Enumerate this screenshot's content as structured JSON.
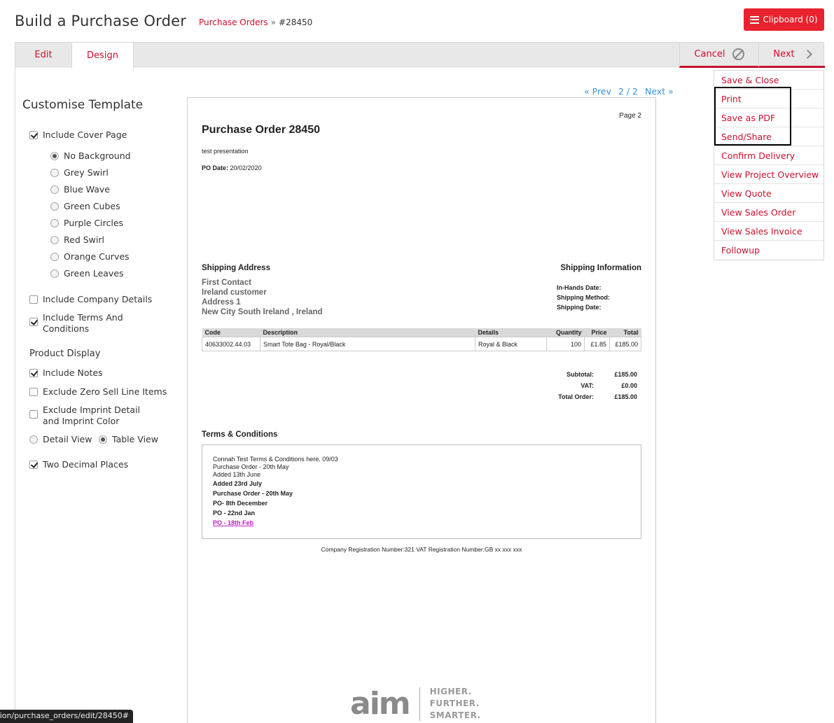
{
  "header": {
    "title": "Build a Purchase Order",
    "breadcrumb_link": "Purchase Orders",
    "breadcrumb_sep": "»",
    "breadcrumb_current": "#28450",
    "clipboard_label": "Clipboard (0)"
  },
  "tabs": {
    "edit": "Edit",
    "design": "Design",
    "cancel": "Cancel",
    "next": "Next"
  },
  "dropdown": [
    "Save & Close",
    "Print",
    "Save as PDF",
    "Send/Share",
    "Confirm Delivery",
    "View Project Overview",
    "View Quote",
    "View Sales Order",
    "View Sales Invoice",
    "Followup"
  ],
  "sidebar": {
    "title": "Customise Template",
    "include_cover_page": "Include Cover Page",
    "backgrounds": [
      "No Background",
      "Grey Swirl",
      "Blue Wave",
      "Green Cubes",
      "Purple Circles",
      "Red Swirl",
      "Orange Curves",
      "Green Leaves"
    ],
    "include_company_details": "Include Company Details",
    "include_terms": "Include Terms And Conditions",
    "product_display": "Product Display",
    "include_notes": "Include Notes",
    "exclude_zero": "Exclude Zero Sell Line Items",
    "exclude_imprint": "Exclude Imprint Detail and Imprint Color",
    "detail_view": "Detail View",
    "table_view": "Table View",
    "two_decimal": "Two Decimal Places"
  },
  "pager": {
    "prev": "« Prev",
    "pages": "2 / 2",
    "next": "Next »"
  },
  "document": {
    "page_label": "Page 2",
    "title": "Purchase Order 28450",
    "subtitle": "test presentation",
    "po_date_label": "PO Date:",
    "po_date": "20/02/2020",
    "shipping_address_heading": "Shipping Address",
    "address_lines": [
      "First Contact",
      "Ireland customer",
      "Address 1",
      "New City South Ireland , Ireland"
    ],
    "shipping_info_heading": "Shipping Information",
    "shipping_info_labels": [
      "In-Hands Date:",
      "Shipping Method:",
      "Shipping Date:"
    ],
    "table_headers": [
      "Code",
      "Description",
      "Details",
      "Quantity",
      "Price",
      "Total"
    ],
    "table_row": [
      "40633002.44.03",
      "Smart Tote Bag - Royal/Black",
      "Royal & Black",
      "100",
      "£1.85",
      "£185.00"
    ],
    "subtotal_label": "Subtotal:",
    "subtotal": "£185.00",
    "vat_label": "VAT:",
    "vat": "£0.00",
    "total_label": "Total Order:",
    "total": "£185.00",
    "terms_heading": "Terms & Conditions",
    "terms_lines": [
      "Connah Test Terms & Conditions here. 09/03",
      "Purchase Order - 20th May",
      "Added 13th June"
    ],
    "terms_bold_lines": [
      "Added 23rd July",
      "Purchase Order - 20th May",
      "PO- 8th December",
      "PO - 22nd Jan"
    ],
    "terms_link": "PO - 18th Feb",
    "registration": "Company Registration Number:321 VAT Registration Number:GB xx xxx xxx"
  },
  "logo": {
    "wordmark": "aim",
    "tagline": [
      "HIGHER.",
      "FURTHER.",
      "SMARTER."
    ]
  },
  "status_url": "ision/purchase_orders/edit/28450#",
  "colors": {
    "accent": "#c8102e",
    "clipboard_bg": "#e8222e",
    "link_blue": "#3b8fd4"
  }
}
